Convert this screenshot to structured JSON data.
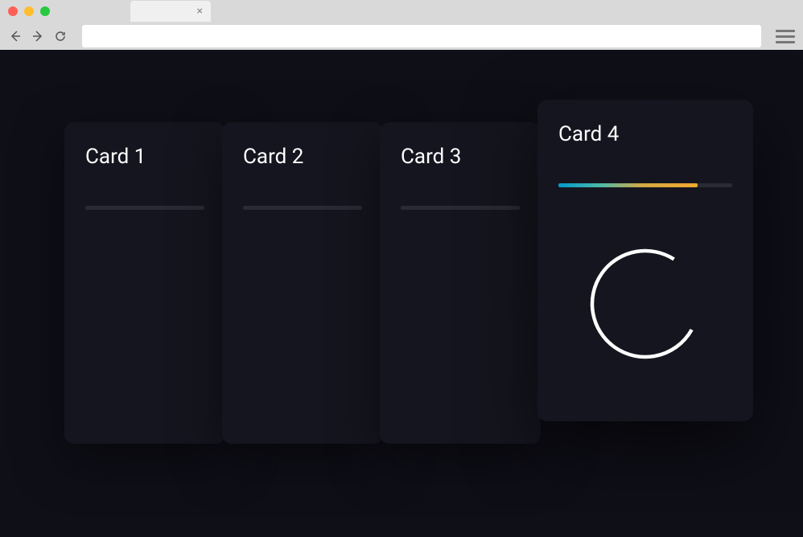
{
  "browser": {
    "tab_close": "×"
  },
  "cards": [
    {
      "title": "Card 1",
      "active": false
    },
    {
      "title": "Card 2",
      "active": false
    },
    {
      "title": "Card 3",
      "active": false
    },
    {
      "title": "Card 4",
      "active": true,
      "progress": 80
    }
  ]
}
